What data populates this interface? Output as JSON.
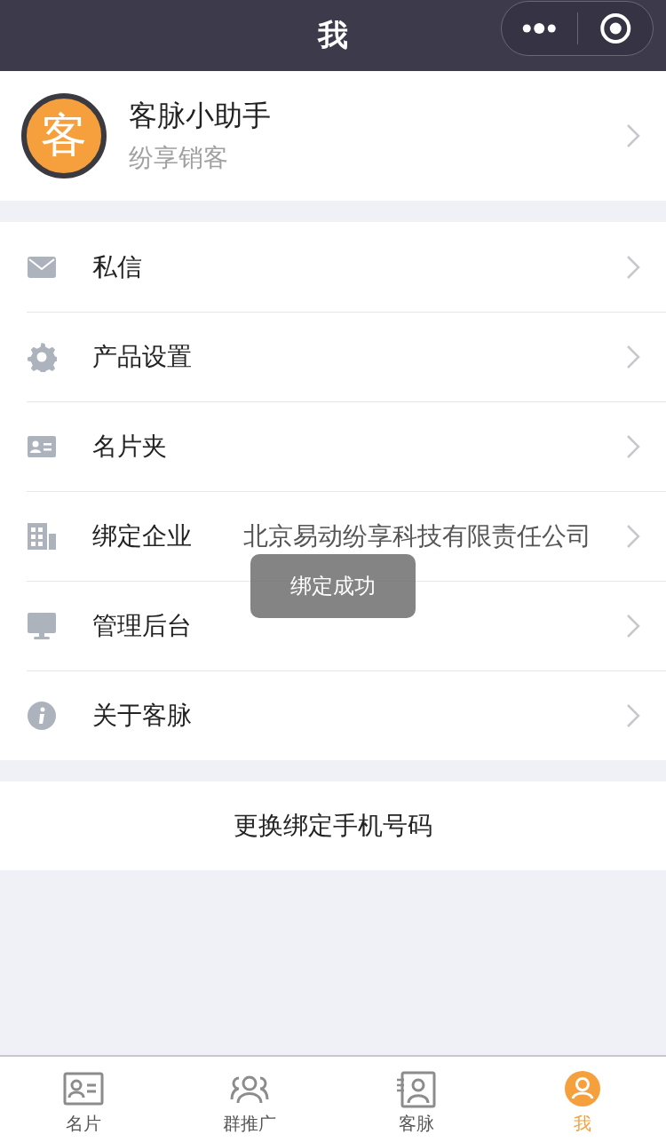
{
  "nav_bar": {
    "title": "我"
  },
  "profile": {
    "name": "客脉小助手",
    "subtitle": "纷享销客",
    "avatar_glyph": "客"
  },
  "menu": [
    {
      "kind": "mail",
      "label": "私信"
    },
    {
      "kind": "gear",
      "label": "产品设置"
    },
    {
      "kind": "card",
      "label": "名片夹"
    },
    {
      "kind": "building",
      "label": "绑定企业",
      "value": "北京易动纷享科技有限责任公司"
    },
    {
      "kind": "monitor",
      "label": "管理后台"
    },
    {
      "kind": "info",
      "label": "关于客脉"
    }
  ],
  "change_phone_button": "更换绑定手机号码",
  "toast": "绑定成功",
  "tab_bar": [
    {
      "kind": "card",
      "label": "名片",
      "selected": false
    },
    {
      "kind": "group",
      "label": "群推广",
      "selected": false
    },
    {
      "kind": "contacts",
      "label": "客脉",
      "selected": false
    },
    {
      "kind": "me",
      "label": "我",
      "selected": true
    }
  ]
}
